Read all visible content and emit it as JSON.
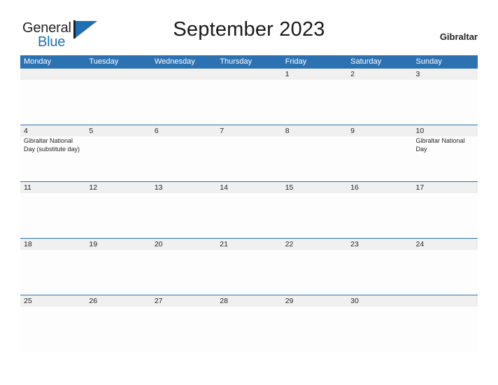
{
  "brand": {
    "name_primary": "General",
    "name_secondary": "Blue",
    "mark_color": "#1f6fb5",
    "primary_color": "#231f20"
  },
  "header": {
    "title": "September 2023",
    "region": "Gibraltar"
  },
  "theme": {
    "header_blue": "#2c72b3",
    "band_gray": "#f0f0f0",
    "page_background": "#ffffff",
    "text_color": "#231f20"
  },
  "calendar": {
    "month": "September",
    "year": "2023",
    "weekday_headers": [
      "Monday",
      "Tuesday",
      "Wednesday",
      "Thursday",
      "Friday",
      "Saturday",
      "Sunday"
    ],
    "weeks": [
      [
        {
          "day": "",
          "events": []
        },
        {
          "day": "",
          "events": []
        },
        {
          "day": "",
          "events": []
        },
        {
          "day": "",
          "events": []
        },
        {
          "day": "1",
          "events": []
        },
        {
          "day": "2",
          "events": []
        },
        {
          "day": "3",
          "events": []
        }
      ],
      [
        {
          "day": "4",
          "events": [
            "Gibraltar National Day (substitute day)"
          ]
        },
        {
          "day": "5",
          "events": []
        },
        {
          "day": "6",
          "events": []
        },
        {
          "day": "7",
          "events": []
        },
        {
          "day": "8",
          "events": []
        },
        {
          "day": "9",
          "events": []
        },
        {
          "day": "10",
          "events": [
            "Gibraltar National Day"
          ]
        }
      ],
      [
        {
          "day": "11",
          "events": []
        },
        {
          "day": "12",
          "events": []
        },
        {
          "day": "13",
          "events": []
        },
        {
          "day": "14",
          "events": []
        },
        {
          "day": "15",
          "events": []
        },
        {
          "day": "16",
          "events": []
        },
        {
          "day": "17",
          "events": []
        }
      ],
      [
        {
          "day": "18",
          "events": []
        },
        {
          "day": "19",
          "events": []
        },
        {
          "day": "20",
          "events": []
        },
        {
          "day": "21",
          "events": []
        },
        {
          "day": "22",
          "events": []
        },
        {
          "day": "23",
          "events": []
        },
        {
          "day": "24",
          "events": []
        }
      ],
      [
        {
          "day": "25",
          "events": []
        },
        {
          "day": "26",
          "events": []
        },
        {
          "day": "27",
          "events": []
        },
        {
          "day": "28",
          "events": []
        },
        {
          "day": "29",
          "events": []
        },
        {
          "day": "30",
          "events": []
        },
        {
          "day": "",
          "events": []
        }
      ]
    ]
  }
}
